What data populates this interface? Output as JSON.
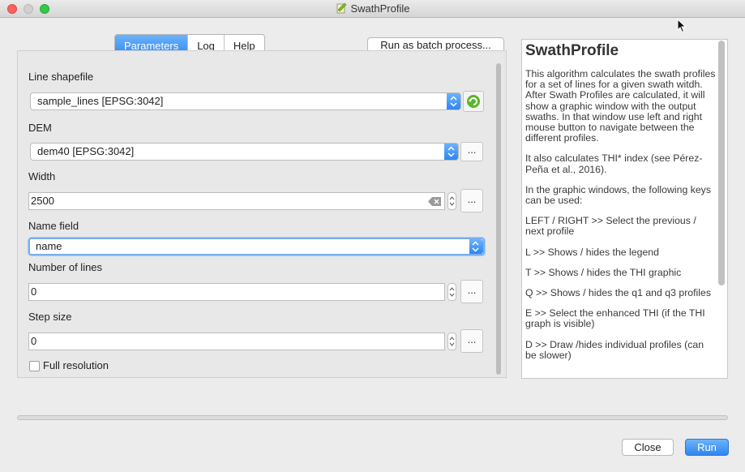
{
  "window": {
    "title": "SwathProfile"
  },
  "tabs": [
    {
      "label": "Parameters",
      "active": true
    },
    {
      "label": "Log",
      "active": false
    },
    {
      "label": "Help",
      "active": false
    }
  ],
  "batch_button": "Run as batch process...",
  "params": {
    "line_shapefile": {
      "label": "Line shapefile",
      "value": "sample_lines [EPSG:3042]"
    },
    "dem": {
      "label": "DEM",
      "value": "dem40 [EPSG:3042]"
    },
    "width": {
      "label": "Width",
      "value": "2500"
    },
    "name_field": {
      "label": "Name field",
      "value": "name"
    },
    "number_of_lines": {
      "label": "Number of lines",
      "value": "0"
    },
    "step_size": {
      "label": "Step size",
      "value": "0"
    },
    "full_resolution": {
      "label": "Full resolution",
      "checked": false
    }
  },
  "dots_label": "...",
  "help": {
    "title": "SwathProfile",
    "paragraphs": [
      "This algorithm calculates the swath profiles for a set of lines for a given swath witdh. After Swath Profiles are calculated, it will show a graphic window with the output swaths. In that window use left and right mouse button to navigate between the different profiles.",
      "It also calculates THI* index (see Pérez-Peña et al., 2016).",
      "In the graphic windows, the following keys can be used:",
      "LEFT / RIGHT >> Select the previous / next profile",
      "L >> Shows / hides the legend",
      "T >> Shows / hides the THI graphic",
      "Q >> Shows / hides the q1 and q3 profiles",
      "E >> Select the enhanced THI (if the THI graph is visible)",
      "D >> Draw /hides individual profiles (can be slower)"
    ]
  },
  "buttons": {
    "close": "Close",
    "run": "Run"
  },
  "colors": {
    "accent": "#2f86f0",
    "titlebar": "#d5d5d5"
  }
}
